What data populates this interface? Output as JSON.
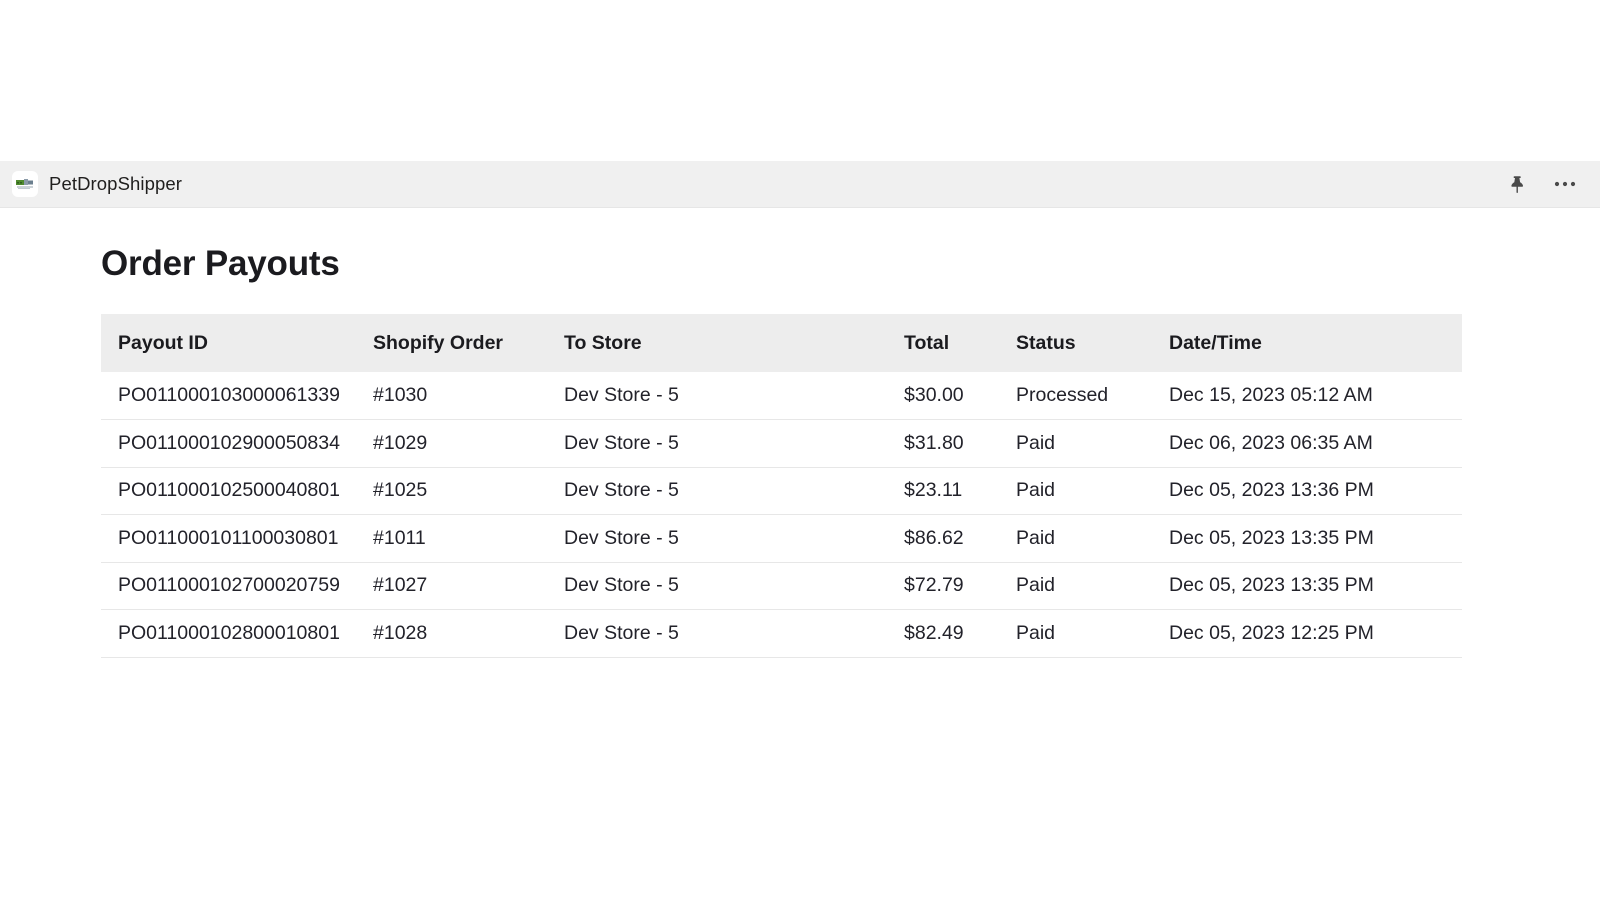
{
  "app_bar": {
    "title": "PetDropShipper",
    "logo_icon": "petdropshipper-logo",
    "pin_icon": "pin-icon",
    "more_icon": "more-options-icon"
  },
  "page": {
    "title": "Order Payouts"
  },
  "table": {
    "columns": [
      {
        "key": "payout_id",
        "label": "Payout ID"
      },
      {
        "key": "shopify_order",
        "label": "Shopify Order"
      },
      {
        "key": "to_store",
        "label": "To Store"
      },
      {
        "key": "total",
        "label": "Total"
      },
      {
        "key": "status",
        "label": "Status"
      },
      {
        "key": "datetime",
        "label": "Date/Time"
      }
    ],
    "rows": [
      {
        "payout_id": "PO011000103000061339",
        "shopify_order": "#1030",
        "to_store": "Dev Store - 5",
        "total": "$30.00",
        "status": "Processed",
        "status_kind": "processed",
        "datetime": "Dec 15, 2023 05:12 AM"
      },
      {
        "payout_id": "PO011000102900050834",
        "shopify_order": "#1029",
        "to_store": "Dev Store - 5",
        "total": "$31.80",
        "status": "Paid",
        "status_kind": "paid",
        "datetime": "Dec 06, 2023 06:35 AM"
      },
      {
        "payout_id": "PO011000102500040801",
        "shopify_order": "#1025",
        "to_store": "Dev Store - 5",
        "total": "$23.11",
        "status": "Paid",
        "status_kind": "paid",
        "datetime": "Dec 05, 2023 13:36 PM"
      },
      {
        "payout_id": "PO011000101100030801",
        "shopify_order": "#1011",
        "to_store": "Dev Store - 5",
        "total": "$86.62",
        "status": "Paid",
        "status_kind": "paid",
        "datetime": "Dec 05, 2023 13:35 PM"
      },
      {
        "payout_id": "PO011000102700020759",
        "shopify_order": "#1027",
        "to_store": "Dev Store - 5",
        "total": "$72.79",
        "status": "Paid",
        "status_kind": "paid",
        "datetime": "Dec 05, 2023 13:35 PM"
      },
      {
        "payout_id": "PO011000102800010801",
        "shopify_order": "#1028",
        "to_store": "Dev Store - 5",
        "total": "$82.49",
        "status": "Paid",
        "status_kind": "paid",
        "datetime": "Dec 05, 2023 12:25 PM"
      }
    ]
  },
  "colors": {
    "status_paid": "#2a7a1f",
    "status_processed": "#f5a623",
    "app_bar_bg": "#f0f0f0",
    "table_header_bg": "#ededed"
  }
}
